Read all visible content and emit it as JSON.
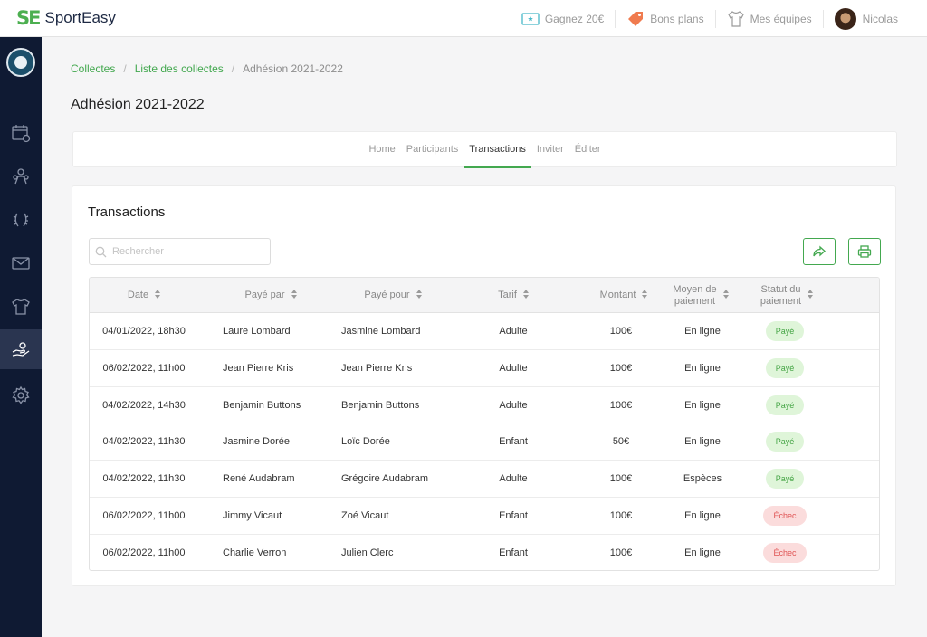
{
  "app": {
    "logo_mark": "SE",
    "logo_text": "SportEasy"
  },
  "topnav": {
    "items": [
      {
        "label": "Gagnez 20€",
        "icon": "ticket-icon"
      },
      {
        "label": "Bons plans",
        "icon": "price-tag-icon"
      },
      {
        "label": "Mes équipes",
        "icon": "jersey-icon"
      },
      {
        "label": "Nicolas",
        "icon": "avatar"
      }
    ]
  },
  "sidebar": {
    "items": [
      {
        "name": "calendar-icon",
        "active": false
      },
      {
        "name": "members-icon",
        "active": false
      },
      {
        "name": "trophy-icon",
        "active": false
      },
      {
        "name": "mail-icon",
        "active": false
      },
      {
        "name": "jersey-icon",
        "active": false
      },
      {
        "name": "payment-hand-icon",
        "active": true
      },
      {
        "name": "gear-icon",
        "active": false
      }
    ]
  },
  "breadcrumb": [
    "Collectes",
    "Liste des collectes",
    "Adhésion 2021-2022"
  ],
  "page_title": "Adhésion 2021-2022",
  "tabs": [
    {
      "label": "Home",
      "active": false
    },
    {
      "label": "Participants",
      "active": false
    },
    {
      "label": "Transactions",
      "active": true
    },
    {
      "label": "Inviter",
      "active": false
    },
    {
      "label": "Éditer",
      "active": false
    }
  ],
  "transactions": {
    "title": "Transactions",
    "search_placeholder": "Rechercher",
    "columns": {
      "date": "Date",
      "paid_by": "Payé par",
      "paid_for": "Payé pour",
      "tarif": "Tarif",
      "montant": "Montant",
      "moyen_1": "Moyen de",
      "moyen_2": "paiement",
      "statut_1": "Statut du",
      "statut_2": "paiement"
    },
    "rows": [
      {
        "date": "04/01/2022, 18h30",
        "paid_by": "Laure Lombard",
        "paid_for": "Jasmine Lombard",
        "tarif": "Adulte",
        "montant": "100€",
        "moyen": "En ligne",
        "statut": "Payé",
        "status_kind": "paid"
      },
      {
        "date": "06/02/2022, 11h00",
        "paid_by": "Jean Pierre Kris",
        "paid_for": "Jean Pierre Kris",
        "tarif": "Adulte",
        "montant": "100€",
        "moyen": "En ligne",
        "statut": "Payé",
        "status_kind": "paid"
      },
      {
        "date": "04/02/2022, 14h30",
        "paid_by": "Benjamin Buttons",
        "paid_for": "Benjamin Buttons",
        "tarif": "Adulte",
        "montant": "100€",
        "moyen": "En ligne",
        "statut": "Payé",
        "status_kind": "paid"
      },
      {
        "date": "04/02/2022, 11h30",
        "paid_by": "Jasmine Dorée",
        "paid_for": "Loïc Dorée",
        "tarif": "Enfant",
        "montant": "50€",
        "moyen": "En ligne",
        "statut": "Payé",
        "status_kind": "paid"
      },
      {
        "date": "04/02/2022, 11h30",
        "paid_by": "René Audabram",
        "paid_for": "Grégoire Audabram",
        "tarif": "Adulte",
        "montant": "100€",
        "moyen": "Espèces",
        "statut": "Payé",
        "status_kind": "paid"
      },
      {
        "date": "06/02/2022, 11h00",
        "paid_by": "Jimmy Vicaut",
        "paid_for": "Zoé Vicaut",
        "tarif": "Enfant",
        "montant": "100€",
        "moyen": "En ligne",
        "statut": "Échec",
        "status_kind": "fail"
      },
      {
        "date": "06/02/2022, 11h00",
        "paid_by": "Charlie Verron",
        "paid_for": "Julien Clerc",
        "tarif": "Enfant",
        "montant": "100€",
        "moyen": "En ligne",
        "statut": "Échec",
        "status_kind": "fail"
      }
    ]
  },
  "colors": {
    "accent": "#43a84f",
    "sidebar": "#0f1a33",
    "paid_bg": "#dff5d9",
    "fail_bg": "#fbdcdc"
  }
}
